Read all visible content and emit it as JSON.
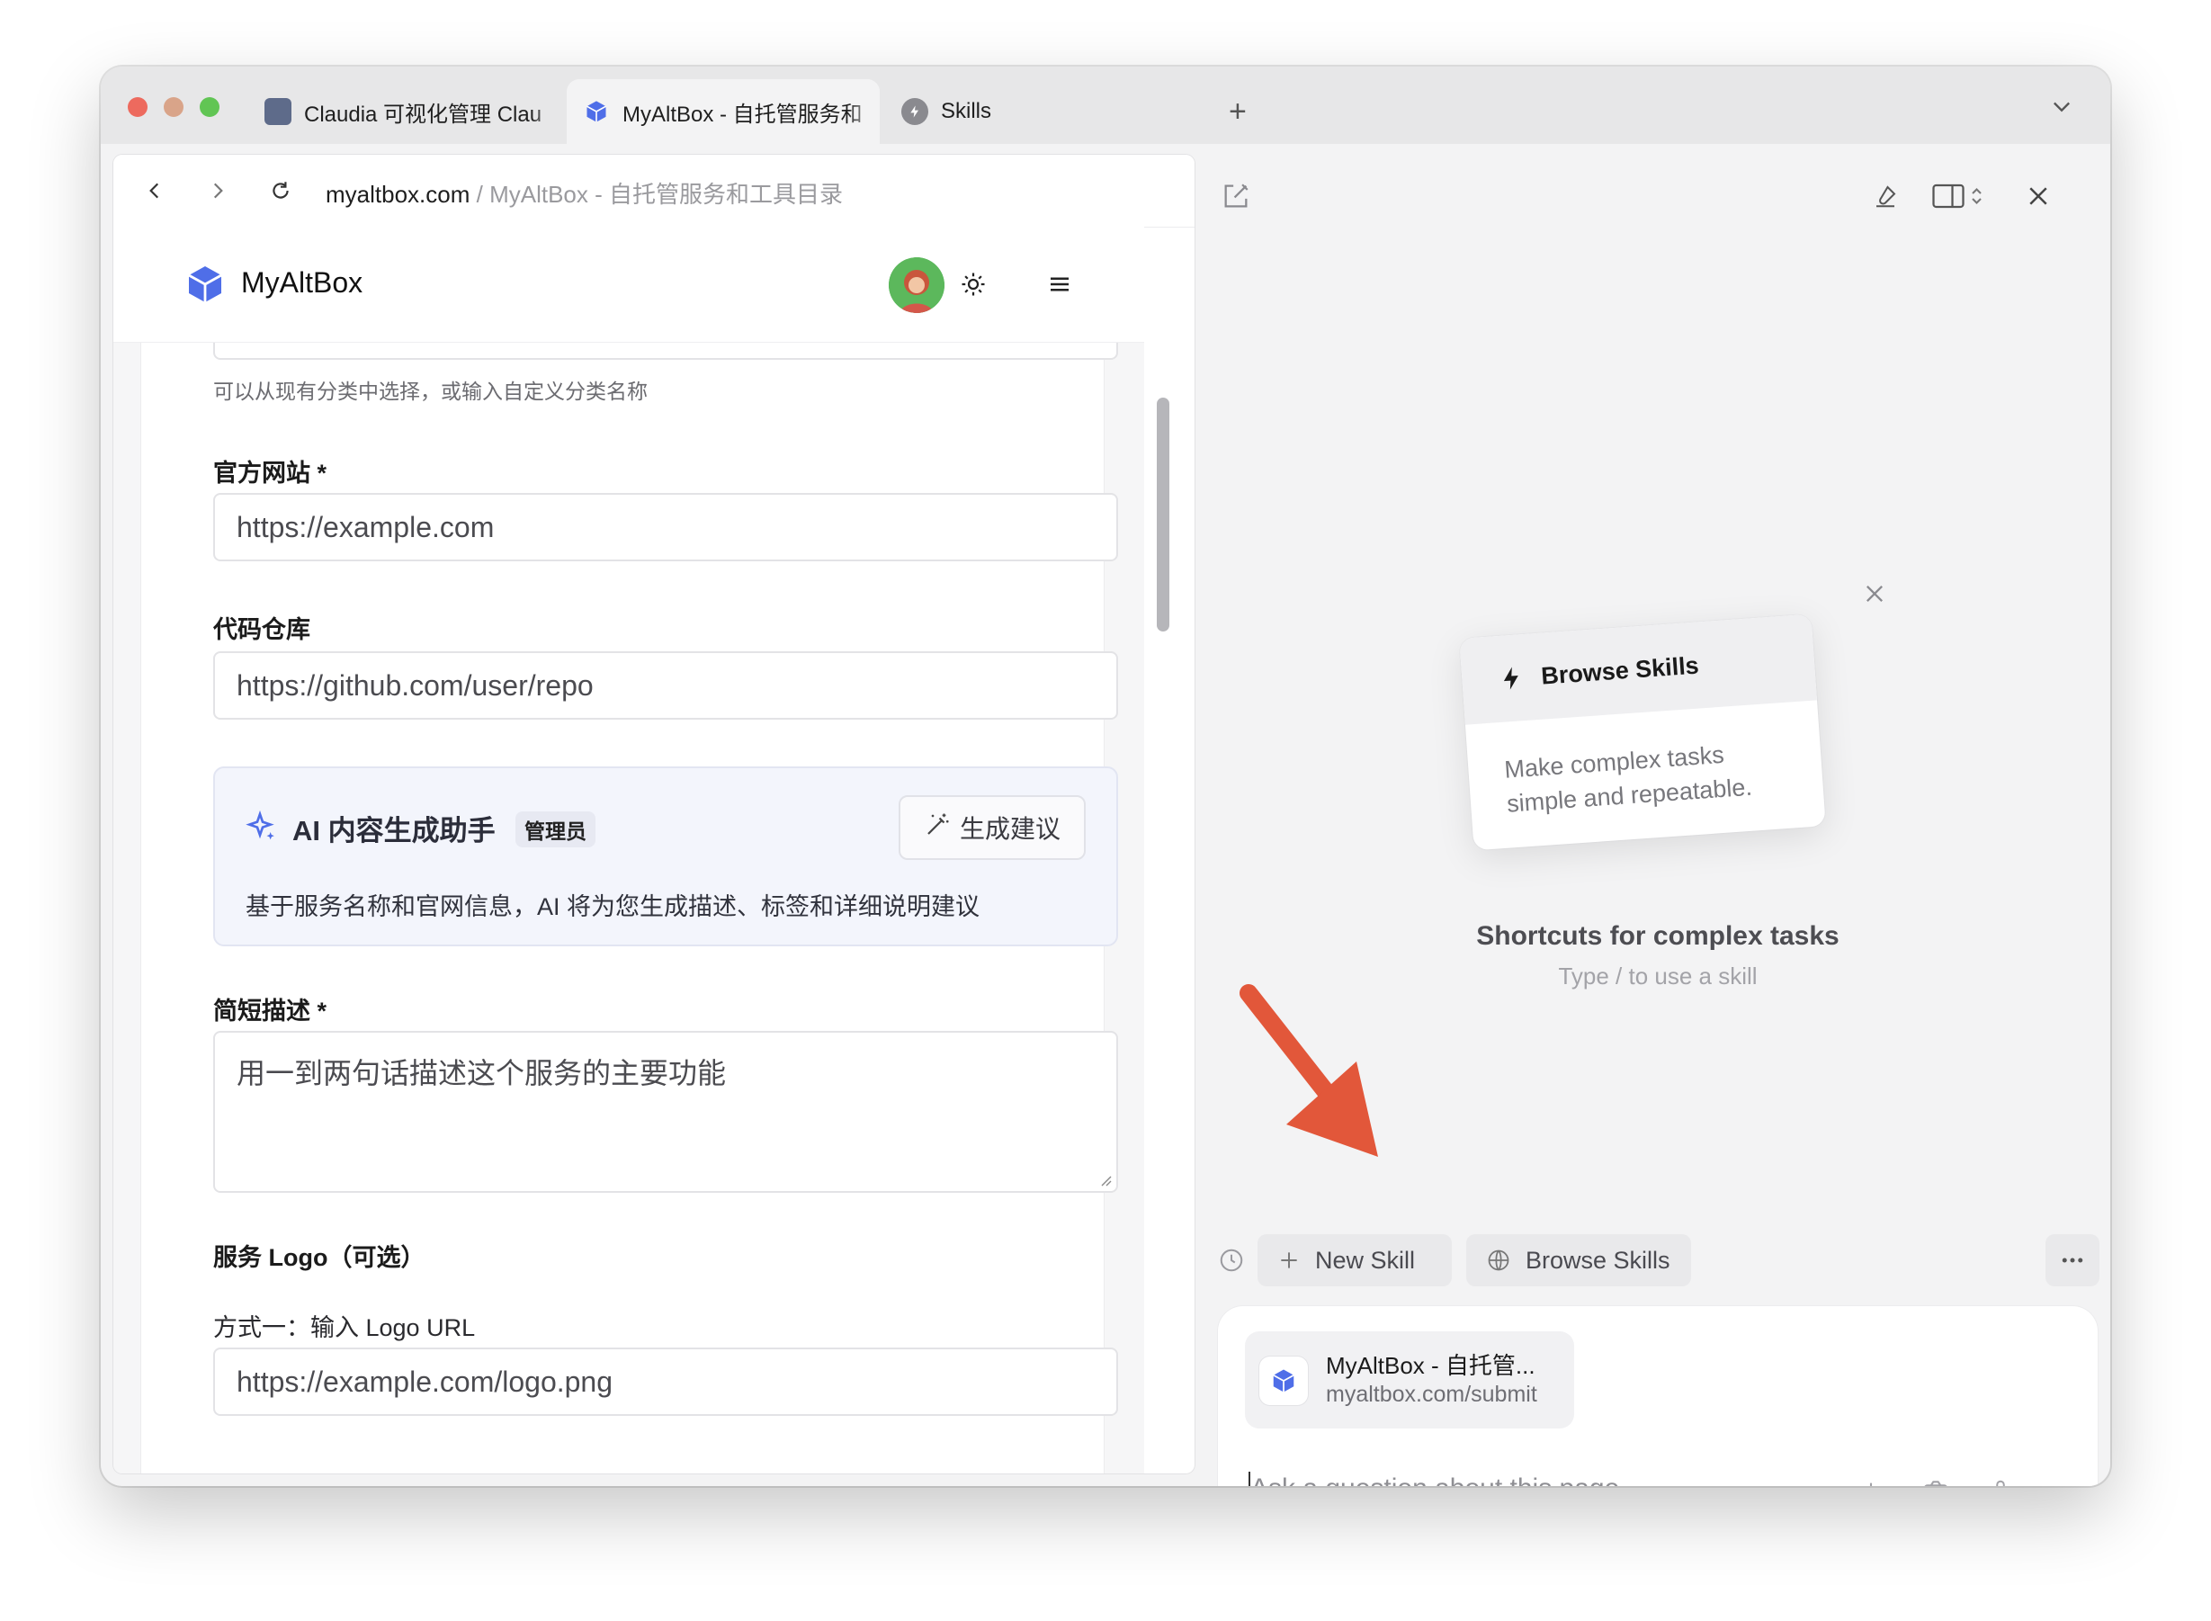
{
  "tabs": [
    {
      "title": "Claudia 可视化管理 Clau",
      "active": false
    },
    {
      "title": "MyAltBox - 自托管服务和",
      "active": true
    },
    {
      "title": "Skills",
      "active": false
    }
  ],
  "new_tab_label": "+",
  "browser": {
    "url_host": "myaltbox.com",
    "url_sep": " / ",
    "url_title": "MyAltBox - 自托管服务和工具目录"
  },
  "site": {
    "brand": "MyAltBox",
    "category_hint": "可以从现有分类中选择，或输入自定义分类名称",
    "website_label": "官方网站 *",
    "website_placeholder": "https://example.com",
    "repo_label": "代码仓库",
    "repo_placeholder": "https://github.com/user/repo",
    "ai": {
      "title": "AI 内容生成助手",
      "badge": "管理员",
      "button": "生成建议",
      "description": "基于服务名称和官网信息，AI 将为您生成描述、标签和详细说明建议"
    },
    "short_desc_label": "简短描述 *",
    "short_desc_placeholder": "用一到两句话描述这个服务的主要功能",
    "logo_section": "服务 Logo（可选）",
    "logo_url_label": "方式一：输入 Logo URL",
    "logo_url_placeholder": "https://example.com/logo.png"
  },
  "assistant": {
    "skill_card_title": "Browse Skills",
    "skill_card_body_line1": "Make complex tasks",
    "skill_card_body_line2": "simple and repeatable.",
    "heading": "Shortcuts for complex tasks",
    "subheading": "Type / to use a skill",
    "new_skill": "New Skill",
    "browse_skills": "Browse Skills",
    "context_title": "MyAltBox - 自托管...",
    "context_url": "myaltbox.com/submit",
    "ask_placeholder": "Ask a question about this page..."
  },
  "colors": {
    "accent_arrow": "#e2573a",
    "logo_blue": "#4f6ee8",
    "traffic_red": "#ed6a5e",
    "traffic_yellow": "#d9a489",
    "traffic_green": "#61c554"
  }
}
